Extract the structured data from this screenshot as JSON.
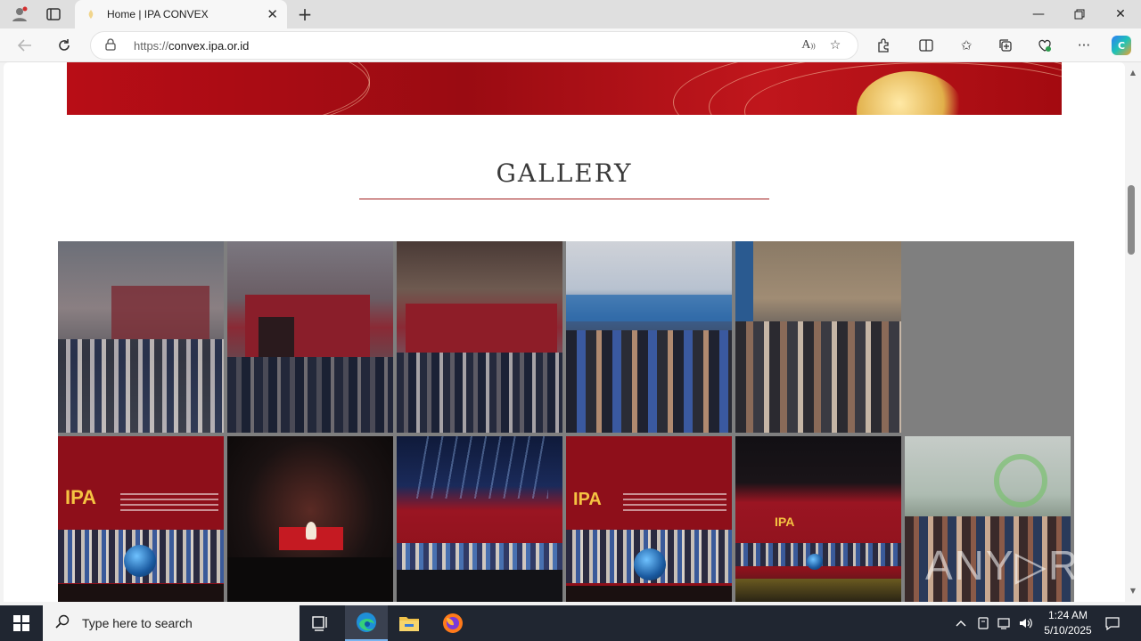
{
  "browser": {
    "tab": {
      "title": "Home | IPA CONVEX"
    },
    "address": {
      "url_proto": "https://",
      "url_host": "convex.ipa.or.id"
    }
  },
  "page": {
    "gallery_heading": "GALLERY"
  },
  "watermark": "ANY▷RUN",
  "taskbar": {
    "search_placeholder": "Type here to search",
    "time": "1:24 AM",
    "date": "5/10/2025"
  },
  "colors": {
    "accent_red": "#a01c1c",
    "banner_red": "#b80d16",
    "taskbar": "#202631"
  }
}
